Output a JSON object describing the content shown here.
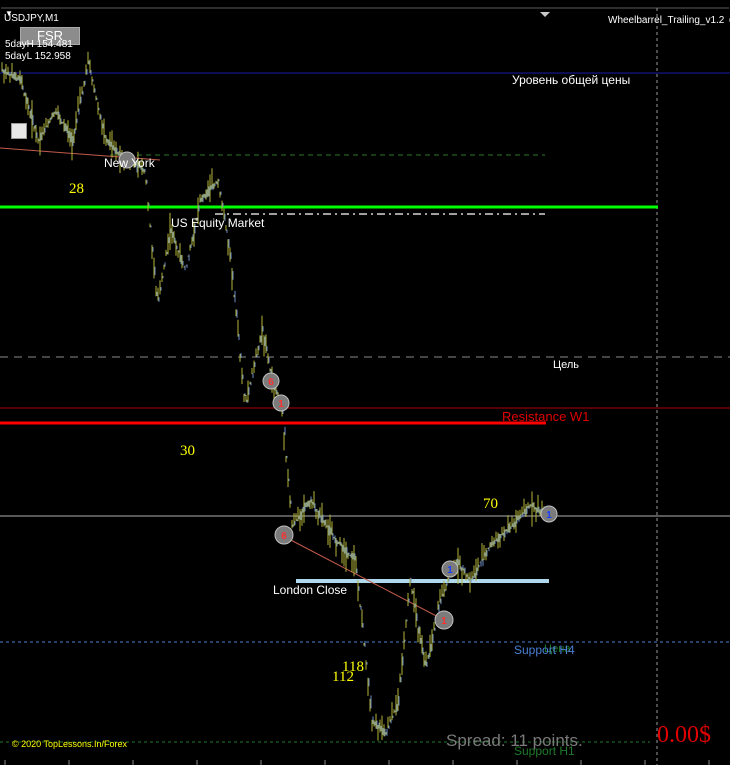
{
  "chart_window": {
    "symbol": "USDJPY,M1",
    "fsr_label": "FSR",
    "five_day_high": "5dayH 154.481",
    "five_day_low": "5dayL 152.958",
    "expert_label": "Wheelbarrel_Trailing_v1.2 ☺",
    "copyright": "© 2020 TopLessons.In/Forex",
    "spread": "Spread: 11 points.",
    "profit": "0.00$"
  },
  "levels": {
    "common_price": "Уровень общей цены",
    "new_york": "New York",
    "us_equity": "US Equity Market",
    "target": "Цель",
    "resistance": "Resistance W1",
    "london_close": "London Close",
    "support_h4": "Support H4",
    "support_h4_overlay": "Цена",
    "support_h1": "Support H1"
  },
  "numbers": {
    "n28": "28",
    "n30": "30",
    "n70": "70",
    "n118": "118",
    "n112": "112"
  },
  "trade_markers": {
    "m1": "6",
    "m2": "1",
    "m3": "6",
    "m4": "1",
    "m5": "1",
    "m6": "1"
  },
  "colors": {
    "background": "#000000",
    "candle_wick": "#b3b33a",
    "candle_body": "#6b8cc7",
    "resistance": "#ff0000",
    "green_level": "#00ff00",
    "support_h4": "#4a7fd6",
    "support_h1": "#1e7a2a",
    "london_line": "#b0d8ec",
    "common_line": "#1a1aa8",
    "number_yellow": "#ffff00"
  }
}
